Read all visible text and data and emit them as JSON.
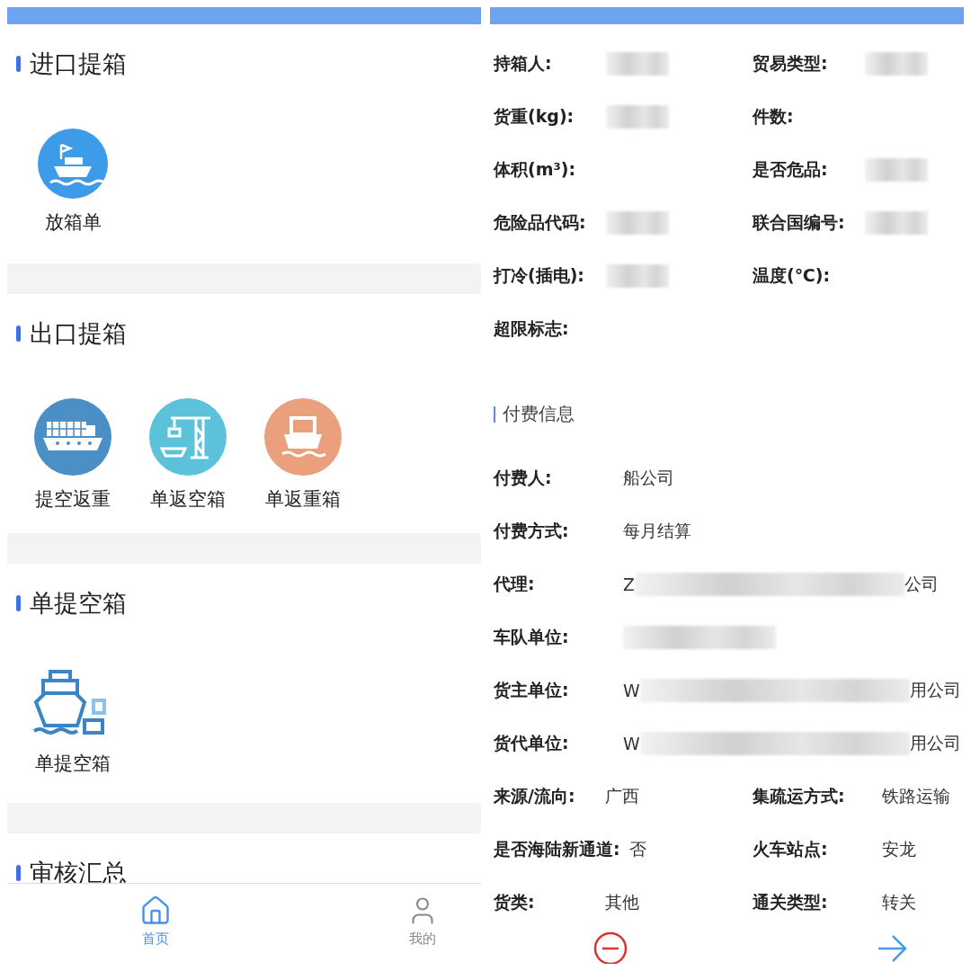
{
  "home_screen": {
    "sections": [
      {
        "title": "进口提箱",
        "items": [
          {
            "label": "放箱单",
            "kind": "flag-ship"
          }
        ]
      },
      {
        "title": "出口提箱",
        "items": [
          {
            "label": "提空返重",
            "kind": "container-ship"
          },
          {
            "label": "单返空箱",
            "kind": "crane"
          },
          {
            "label": "单返重箱",
            "kind": "ferry"
          }
        ]
      },
      {
        "title": "单提空箱",
        "items": [
          {
            "label": "单提空箱",
            "kind": "outline-ship"
          }
        ]
      },
      {
        "title": "审核汇总"
      }
    ],
    "tab_bar": [
      {
        "label": "首页",
        "kind": "home",
        "selected": true
      },
      {
        "label": "我的",
        "kind": "user",
        "selected": false
      }
    ]
  },
  "detail_screen": {
    "cargo_rows": [
      [
        {
          "label": "持箱人:",
          "redacted": true
        },
        {
          "label": "贸易类型:",
          "redacted": true
        }
      ],
      [
        {
          "label": "货重(kg):",
          "redacted": true
        },
        {
          "label": "件数:"
        }
      ],
      [
        {
          "label": "体积(m³):"
        },
        {
          "label": "是否危品:",
          "redacted": true
        }
      ],
      [
        {
          "label": "危险品代码:",
          "redacted": true
        },
        {
          "label": "联合国编号:",
          "redacted": true
        }
      ],
      [
        {
          "label": "打冷(插电):",
          "redacted": true
        },
        {
          "label": "温度(℃):"
        }
      ],
      [
        {
          "label": "超限标志:"
        }
      ]
    ],
    "payment_title": "付费信息",
    "payment_rows": [
      [
        {
          "label": "付费人:",
          "value": "船公司"
        }
      ],
      [
        {
          "label": "付费方式:",
          "value": "每月结算"
        }
      ],
      [
        {
          "label": "代理:",
          "value_start": "Z",
          "redacted": true,
          "value_end": "公司"
        }
      ],
      [
        {
          "label": "车队单位:",
          "redacted": true
        }
      ],
      [
        {
          "label": "货主单位:",
          "value_start": "W",
          "redacted": true,
          "value_end": "用公司"
        }
      ],
      [
        {
          "label": "货代单位:",
          "value_start": "W",
          "redacted": true,
          "value_end": "用公司"
        }
      ],
      [
        {
          "label": "来源/流向:",
          "value": "广西"
        },
        {
          "label": "集疏运方式:",
          "value": "铁路运输"
        }
      ],
      [
        {
          "label": "是否海陆新通道:",
          "value": "否"
        },
        {
          "label": "火车站点:",
          "value": "安龙"
        }
      ],
      [
        {
          "label": "货类:",
          "value": "其他"
        },
        {
          "label": "通关类型:",
          "value": "转关"
        }
      ]
    ]
  }
}
